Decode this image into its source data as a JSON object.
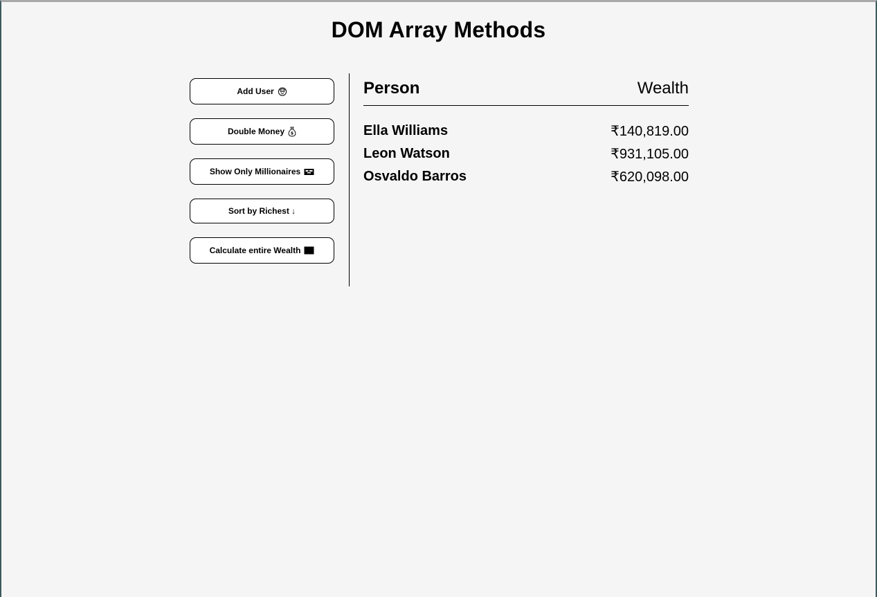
{
  "page": {
    "title": "DOM Array Methods"
  },
  "buttons": {
    "add_user": {
      "label": "Add User",
      "icon": "face-emoji-icon"
    },
    "double_money": {
      "label": "Double Money",
      "icon": "money-bag-icon"
    },
    "show_millionaires": {
      "label": "Show Only Millionaires",
      "icon": "flag-badge-icon"
    },
    "sort_richest": {
      "label": "Sort by Richest ↓",
      "icon": "down-arrow"
    },
    "calculate_wealth": {
      "label": "Calculate entire Wealth",
      "icon": "black-square-icon"
    }
  },
  "table": {
    "headers": {
      "person": "Person",
      "wealth": "Wealth"
    },
    "rows": [
      {
        "name": "Ella Williams",
        "wealth": "₹140,819.00"
      },
      {
        "name": "Leon Watson",
        "wealth": "₹931,105.00"
      },
      {
        "name": "Osvaldo Barros",
        "wealth": "₹620,098.00"
      }
    ]
  },
  "colors": {
    "background": "#f5f5f5",
    "button_background": "#ffffff",
    "text": "#000000"
  }
}
